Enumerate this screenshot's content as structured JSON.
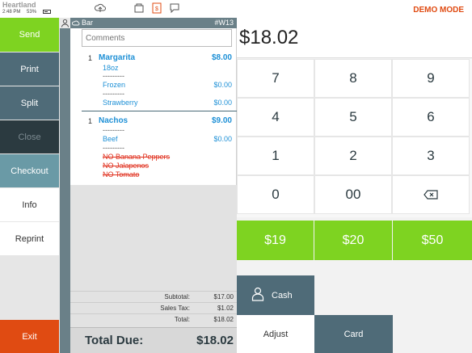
{
  "status": {
    "brand": "Heartland",
    "time": "2:48 PM",
    "battery": "53%",
    "mode": "DEMO MODE"
  },
  "menu": {
    "send": "Send",
    "print": "Print",
    "split": "Split",
    "close": "Close",
    "checkout": "Checkout",
    "info": "Info",
    "reprint": "Reprint",
    "exit": "Exit"
  },
  "ticket": {
    "name": "Bar",
    "number": "#W13",
    "comments_placeholder": "Comments",
    "items": [
      {
        "qty": "1",
        "name": "Margarita",
        "price": "$8.00",
        "mods": [
          {
            "text": "18oz",
            "price": ""
          },
          {
            "text": "---------",
            "price": ""
          },
          {
            "text": "Frozen",
            "price": "$0.00"
          },
          {
            "text": "---------",
            "price": ""
          },
          {
            "text": "Strawberry",
            "price": "$0.00"
          }
        ]
      },
      {
        "qty": "1",
        "name": "Nachos",
        "price": "$9.00",
        "mods": [
          {
            "text": "---------",
            "price": ""
          },
          {
            "text": "Beef",
            "price": "$0.00"
          },
          {
            "text": "---------",
            "price": ""
          },
          {
            "text": "NO Banana Peppers",
            "price": ""
          },
          {
            "text": "NO Jalapenos",
            "price": ""
          },
          {
            "text": "NO Tomato",
            "price": ""
          }
        ]
      }
    ],
    "subtotal_label": "Subtotal:",
    "subtotal": "$17.00",
    "tax_label": "Sales Tax:",
    "tax": "$1.02",
    "total_label": "Total:",
    "total": "$18.02",
    "total_due_label": "Total Due:",
    "total_due": "$18.02"
  },
  "payment": {
    "amount": "$18.02",
    "keys": [
      "7",
      "8",
      "9",
      "4",
      "5",
      "6",
      "1",
      "2",
      "3",
      "0",
      "00"
    ],
    "quick": [
      "$19",
      "$20",
      "$50"
    ],
    "cash": "Cash",
    "adjust": "Adjust",
    "card": "Card"
  },
  "colors": {
    "accent_green": "#7ed321",
    "slate": "#4f6b78",
    "exit_orange": "#e04b12",
    "link_blue": "#1e90d6",
    "removed_red": "#e0301e"
  }
}
